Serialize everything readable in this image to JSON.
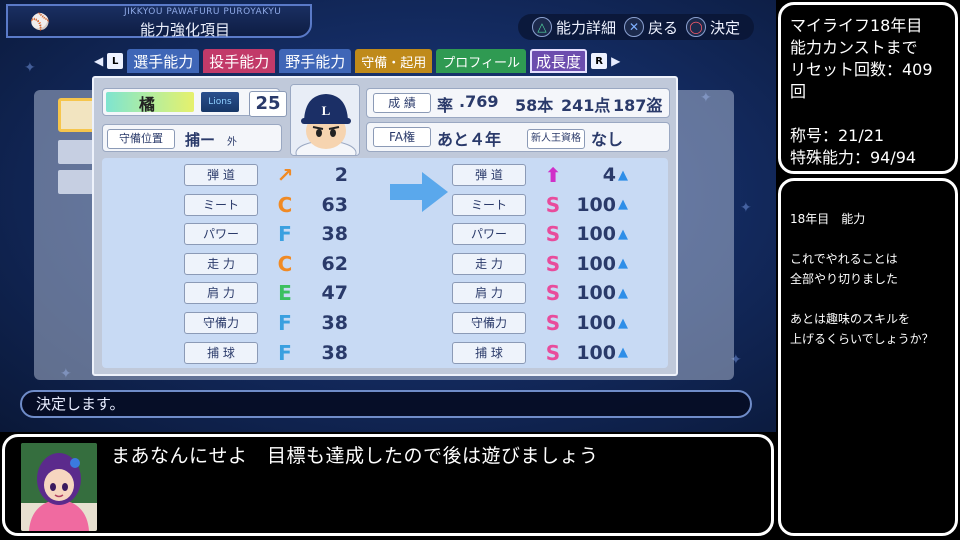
{
  "header": {
    "subtitle": "JIKKYOU PAWAFURU PUROYAKYU",
    "title": "能力強化項目"
  },
  "controls": [
    {
      "symbol": "△",
      "label": "能力詳細"
    },
    {
      "symbol": "✕",
      "label": "戻る"
    },
    {
      "symbol": "◯",
      "label": "決定"
    }
  ],
  "tabs": [
    {
      "label": "選手能力",
      "color": "#3f66b7"
    },
    {
      "label": "投手能力",
      "color": "#c23a69"
    },
    {
      "label": "野手能力",
      "color": "#3f66b7"
    },
    {
      "label": "守備・起用",
      "color": "#bf8a1a"
    },
    {
      "label": "プロフィール",
      "color": "#2f9a52"
    },
    {
      "label": "成長度",
      "color": "#6c4dae"
    }
  ],
  "shoulder_left": "L",
  "shoulder_right": "R",
  "player": {
    "name": "橘",
    "team_logo": "Lions",
    "number": "25",
    "position_label": "守備位置",
    "position": "捕",
    "position_dash": "ー",
    "position_sub": "外",
    "cap_letter": "L"
  },
  "info": {
    "record_label": "成 績",
    "avg_prefix": "率",
    "avg": ".769",
    "hr": "58本",
    "rbi": "241点",
    "sb": "187盗",
    "fa_label": "FA権",
    "fa_value": "あと４年",
    "rookie_label": "新人王資格",
    "rookie_value": "なし"
  },
  "stats_before": [
    {
      "label": "弾 道",
      "grade": "↗",
      "grade_color": "#f08a24",
      "value": "2"
    },
    {
      "label": "ミート",
      "grade": "C",
      "grade_color": "#f08a24",
      "value": "63"
    },
    {
      "label": "パワー",
      "grade": "F",
      "grade_color": "#3aa0e0",
      "value": "38"
    },
    {
      "label": "走 力",
      "grade": "C",
      "grade_color": "#f08a24",
      "value": "62"
    },
    {
      "label": "肩 力",
      "grade": "E",
      "grade_color": "#3cc060",
      "value": "47"
    },
    {
      "label": "守備力",
      "grade": "F",
      "grade_color": "#3aa0e0",
      "value": "38"
    },
    {
      "label": "捕 球",
      "grade": "F",
      "grade_color": "#3aa0e0",
      "value": "38"
    }
  ],
  "stats_after": [
    {
      "label": "弾 道",
      "grade": "⬆",
      "grade_color": "#d030c8",
      "value": "4"
    },
    {
      "label": "ミート",
      "grade": "S",
      "grade_color": "#e84c9c",
      "value": "100"
    },
    {
      "label": "パワー",
      "grade": "S",
      "grade_color": "#e84c9c",
      "value": "100"
    },
    {
      "label": "走 力",
      "grade": "S",
      "grade_color": "#e84c9c",
      "value": "100"
    },
    {
      "label": "肩 力",
      "grade": "S",
      "grade_color": "#e84c9c",
      "value": "100"
    },
    {
      "label": "守備力",
      "grade": "S",
      "grade_color": "#e84c9c",
      "value": "100"
    },
    {
      "label": "捕 球",
      "grade": "S",
      "grade_color": "#e84c9c",
      "value": "100"
    }
  ],
  "message": "決定します。",
  "side_top": {
    "line1": "マイライフ18年目",
    "line2": "能力カンストまで",
    "line3": "リセット回数：409回",
    "line4": "称号：21/21",
    "line5": "特殊能力：94/94"
  },
  "side_bottom": {
    "heading": "18年目　能力",
    "p1a": "これでやれることは",
    "p1b": "全部やり切りました",
    "p2a": "あとは趣味のスキルを",
    "p2b": "上げるくらいでしょうか？"
  },
  "dialog": {
    "text": "まあなんにせよ　目標も達成したので後は遊びましょう"
  }
}
